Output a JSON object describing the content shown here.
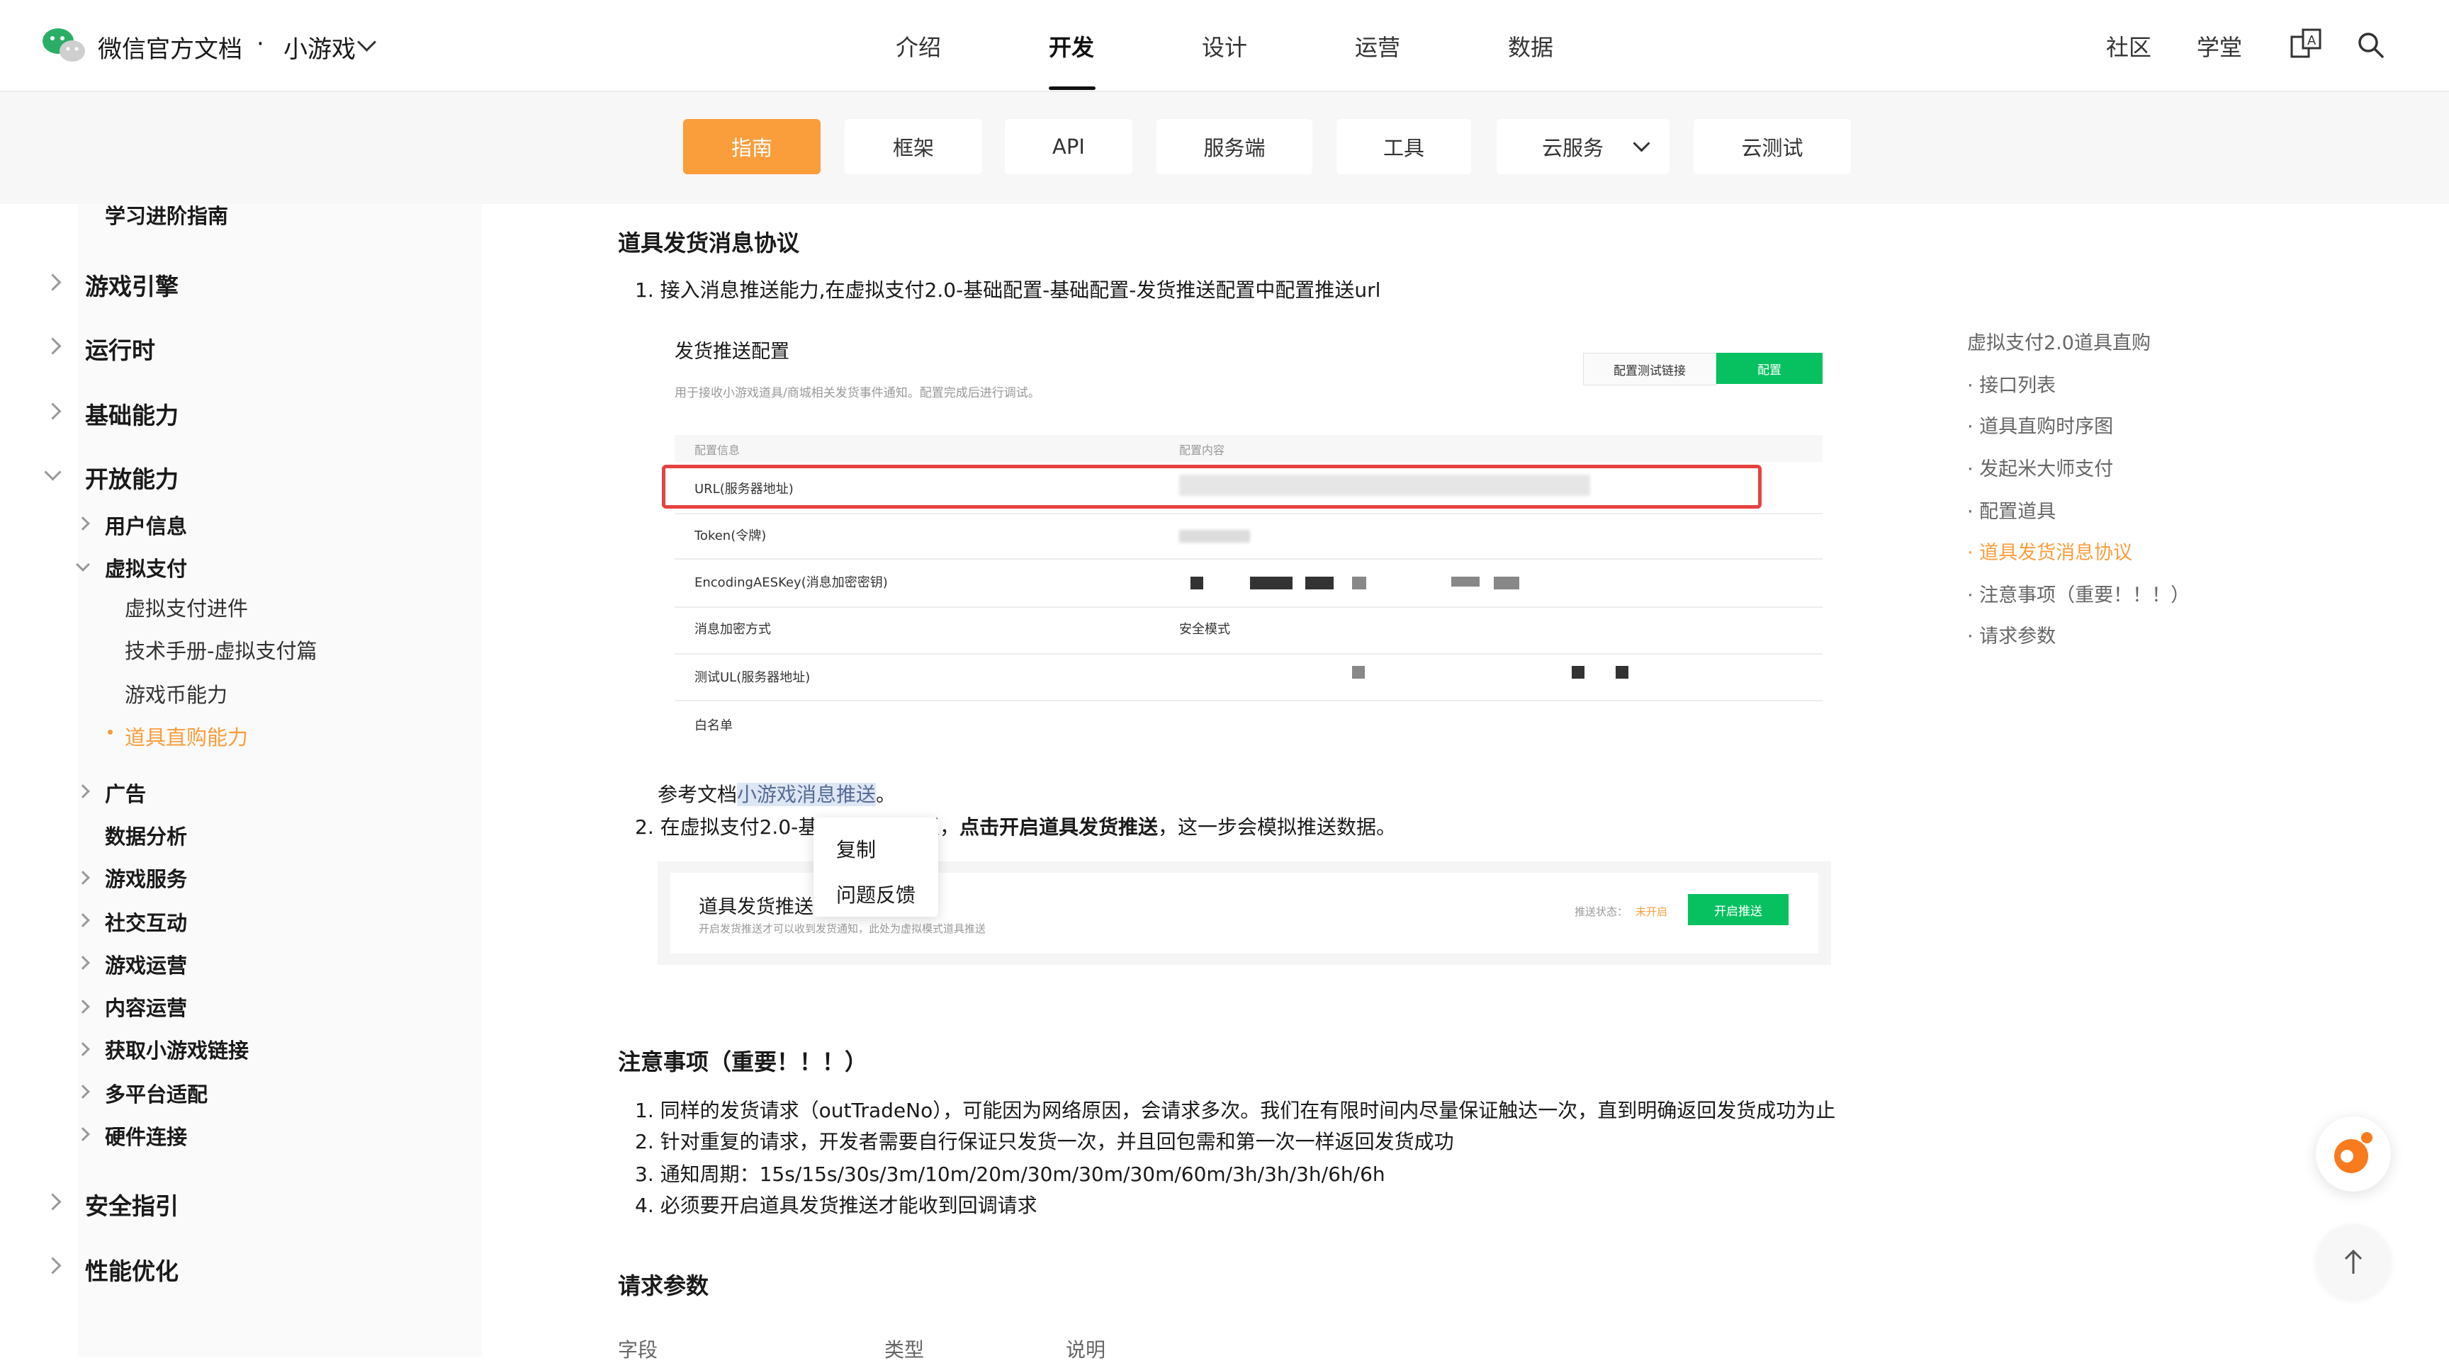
{
  "header": {
    "brand": "微信官方文档",
    "separator": "·",
    "product": "小游戏",
    "nav": [
      "介绍",
      "开发",
      "设计",
      "运营",
      "数据"
    ],
    "active_nav": "开发",
    "right_links": [
      "社区",
      "学堂"
    ]
  },
  "tabs": [
    {
      "label": "指南",
      "active": true
    },
    {
      "label": "框架"
    },
    {
      "label": "API"
    },
    {
      "label": "服务端"
    },
    {
      "label": "工具"
    },
    {
      "label": "云服务"
    },
    {
      "label": "云测试"
    }
  ],
  "sidebar": {
    "items": [
      {
        "label": "学习进阶指南"
      },
      {
        "label": "游戏引擎"
      },
      {
        "label": "运行时"
      },
      {
        "label": "基础能力"
      },
      {
        "label": "开放能力"
      },
      {
        "label": "用户信息"
      },
      {
        "label": "虚拟支付"
      },
      {
        "label": "虚拟支付进件"
      },
      {
        "label": "技术手册-虚拟支付篇"
      },
      {
        "label": "游戏币能力"
      },
      {
        "label": "道具直购能力"
      },
      {
        "label": "广告"
      },
      {
        "label": "数据分析"
      },
      {
        "label": "游戏服务"
      },
      {
        "label": "社交互动"
      },
      {
        "label": "游戏运营"
      },
      {
        "label": "内容运营"
      },
      {
        "label": "获取小游戏链接"
      },
      {
        "label": "多平台适配"
      },
      {
        "label": "硬件连接"
      },
      {
        "label": "安全指引"
      },
      {
        "label": "性能优化"
      }
    ]
  },
  "content": {
    "section1_title": "道具发货消息协议",
    "step1": "1. 接入消息推送能力,在虚拟支付2.0-基础配置-基础配置-发货推送配置中配置推送url",
    "config": {
      "title": "发货推送配置",
      "desc": "用于接收小游戏道具/商城相关发货事件通知。配置完成后进行调试。",
      "btn_test": "配置测试链接",
      "btn_config": "配置",
      "col1": "配置信息",
      "col2": "配置内容",
      "rows": [
        "URL(服务器地址)",
        "Token(令牌)",
        "EncodingAESKey(消息加密密钥)",
        "消息加密方式",
        "测试UL(服务器地址)",
        "白名单"
      ],
      "encrypt_value": "安全模式"
    },
    "ref_prefix": "参考文档",
    "ref_link": "小游戏消息推送",
    "ref_suffix": "。",
    "step2_a": "2. 在虚拟支付2.0-基",
    "step2_b": "置，",
    "step2_bold": "点击开启道具发货推送",
    "step2_c": "，这一步会模拟推送数据。",
    "push": {
      "title": "道具发货推送",
      "desc": "开启发货推送才可以收到发货通知，此处为虚拟模式道具推送",
      "status_label": "推送状态：",
      "status_value": "未开启",
      "button": "开启推送"
    },
    "context_menu": [
      "复制",
      "问题反馈"
    ],
    "section2_title": "注意事项（重要！！！）",
    "notes": [
      "1. 同样的发货请求（outTradeNo），可能因为网络原因，会请求多次。我们在有限时间内尽量保证触达一次，直到明确返回发货成功为止",
      "2. 针对重复的请求，开发者需要自行保证只发货一次，并且回包需和第一次一样返回发货成功",
      "3. 通知周期：15s/15s/30s/3m/10m/20m/30m/30m/30m/60m/3h/3h/3h/6h/6h",
      "4. 必须要开启道具发货推送才能收到回调请求"
    ],
    "section3_title": "请求参数",
    "table_headers": [
      "字段",
      "类型",
      "说明"
    ]
  },
  "toc": {
    "items": [
      {
        "label": "虚拟支付2.0道具直购"
      },
      {
        "label": "· 接口列表"
      },
      {
        "label": "· 道具直购时序图"
      },
      {
        "label": "· 发起米大师支付"
      },
      {
        "label": "· 配置道具"
      },
      {
        "label": "· 道具发货消息协议",
        "active": true
      },
      {
        "label": "· 注意事项（重要！！！）"
      },
      {
        "label": "· 请求参数"
      }
    ]
  },
  "colors": {
    "accent": "#fa9d3b",
    "green": "#07c160",
    "red_highlight": "#e64340"
  }
}
